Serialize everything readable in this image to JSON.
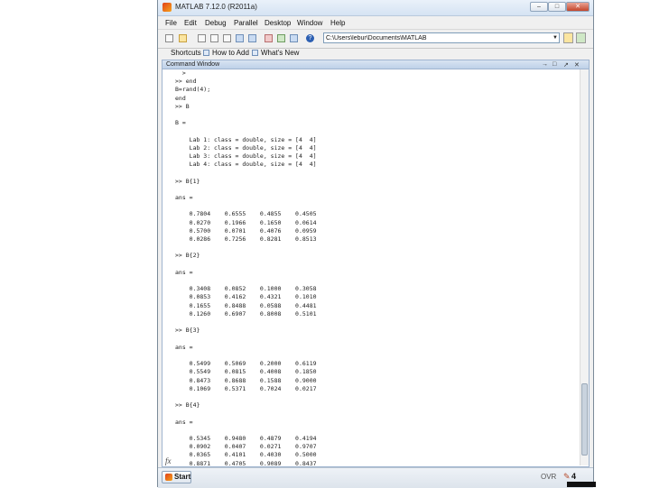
{
  "window": {
    "title": "MATLAB 7.12.0 (R2011a)",
    "controls": {
      "minimize": "–",
      "maximize": "□",
      "close": "✕"
    }
  },
  "menu": [
    {
      "id": "file",
      "label": "File"
    },
    {
      "id": "edit",
      "label": "Edit"
    },
    {
      "id": "debug",
      "label": "Debug"
    },
    {
      "id": "parallel",
      "label": "Parallel"
    },
    {
      "id": "desktop",
      "label": "Desktop"
    },
    {
      "id": "window",
      "label": "Window"
    },
    {
      "id": "help",
      "label": "Help"
    }
  ],
  "toolbar": {
    "help_glyph": "?",
    "current_folder_path": "C:\\Users\\lebur\\Documents\\MATLAB",
    "dropdown_glyph": "▼"
  },
  "shortcuts": {
    "shortcuts_label": "Shortcuts",
    "how_to_add_label": "How to Add",
    "whats_new_label": "What's New"
  },
  "command_window": {
    "title": "Command Window",
    "controls": [
      "→",
      "□",
      "↗",
      "✕"
    ],
    "output": "  >\n>> end\nB=rand(4);\nend\n>> B\n\nB =\n\n    Lab 1: class = double, size = [4  4]\n    Lab 2: class = double, size = [4  4]\n    Lab 3: class = double, size = [4  4]\n    Lab 4: class = double, size = [4  4]\n\n>> B{1}\n\nans =\n\n    0.7804    0.6555    0.4855    0.4505\n    0.0270    0.1966    0.1650    0.0614\n    0.5700    0.0701    0.4076    0.0959\n    0.0286    0.7256    0.8281    0.8513\n\n>> B{2}\n\nans =\n\n    0.3408    0.0852    0.1000    0.3058\n    0.0853    0.4162    0.4321    0.1010\n    0.1655    0.8488    0.0588    0.4481\n    0.1260    0.6907    0.8008    0.5101\n\n>> B{3}\n\nans =\n\n    0.5499    0.5069    0.2000    0.6119\n    0.5549    0.0815    0.4008    0.1850\n    0.8473    0.8688    0.1588    0.9000\n    0.1069    0.5371    0.7024    0.0217\n\n>> B{4}\n\nans =\n\n    0.5345    0.9480    0.4879    0.4194\n    0.0902    0.0407    0.0271    0.9707\n    0.0365    0.4101    0.4030    0.5000\n    0.8871    0.4705    0.9089    0.8437",
    "fx_label": "fx"
  },
  "statusbar": {
    "start_label": "Start",
    "ovr_label": "OVR",
    "status_glyph": "✎",
    "line_number": "4"
  }
}
